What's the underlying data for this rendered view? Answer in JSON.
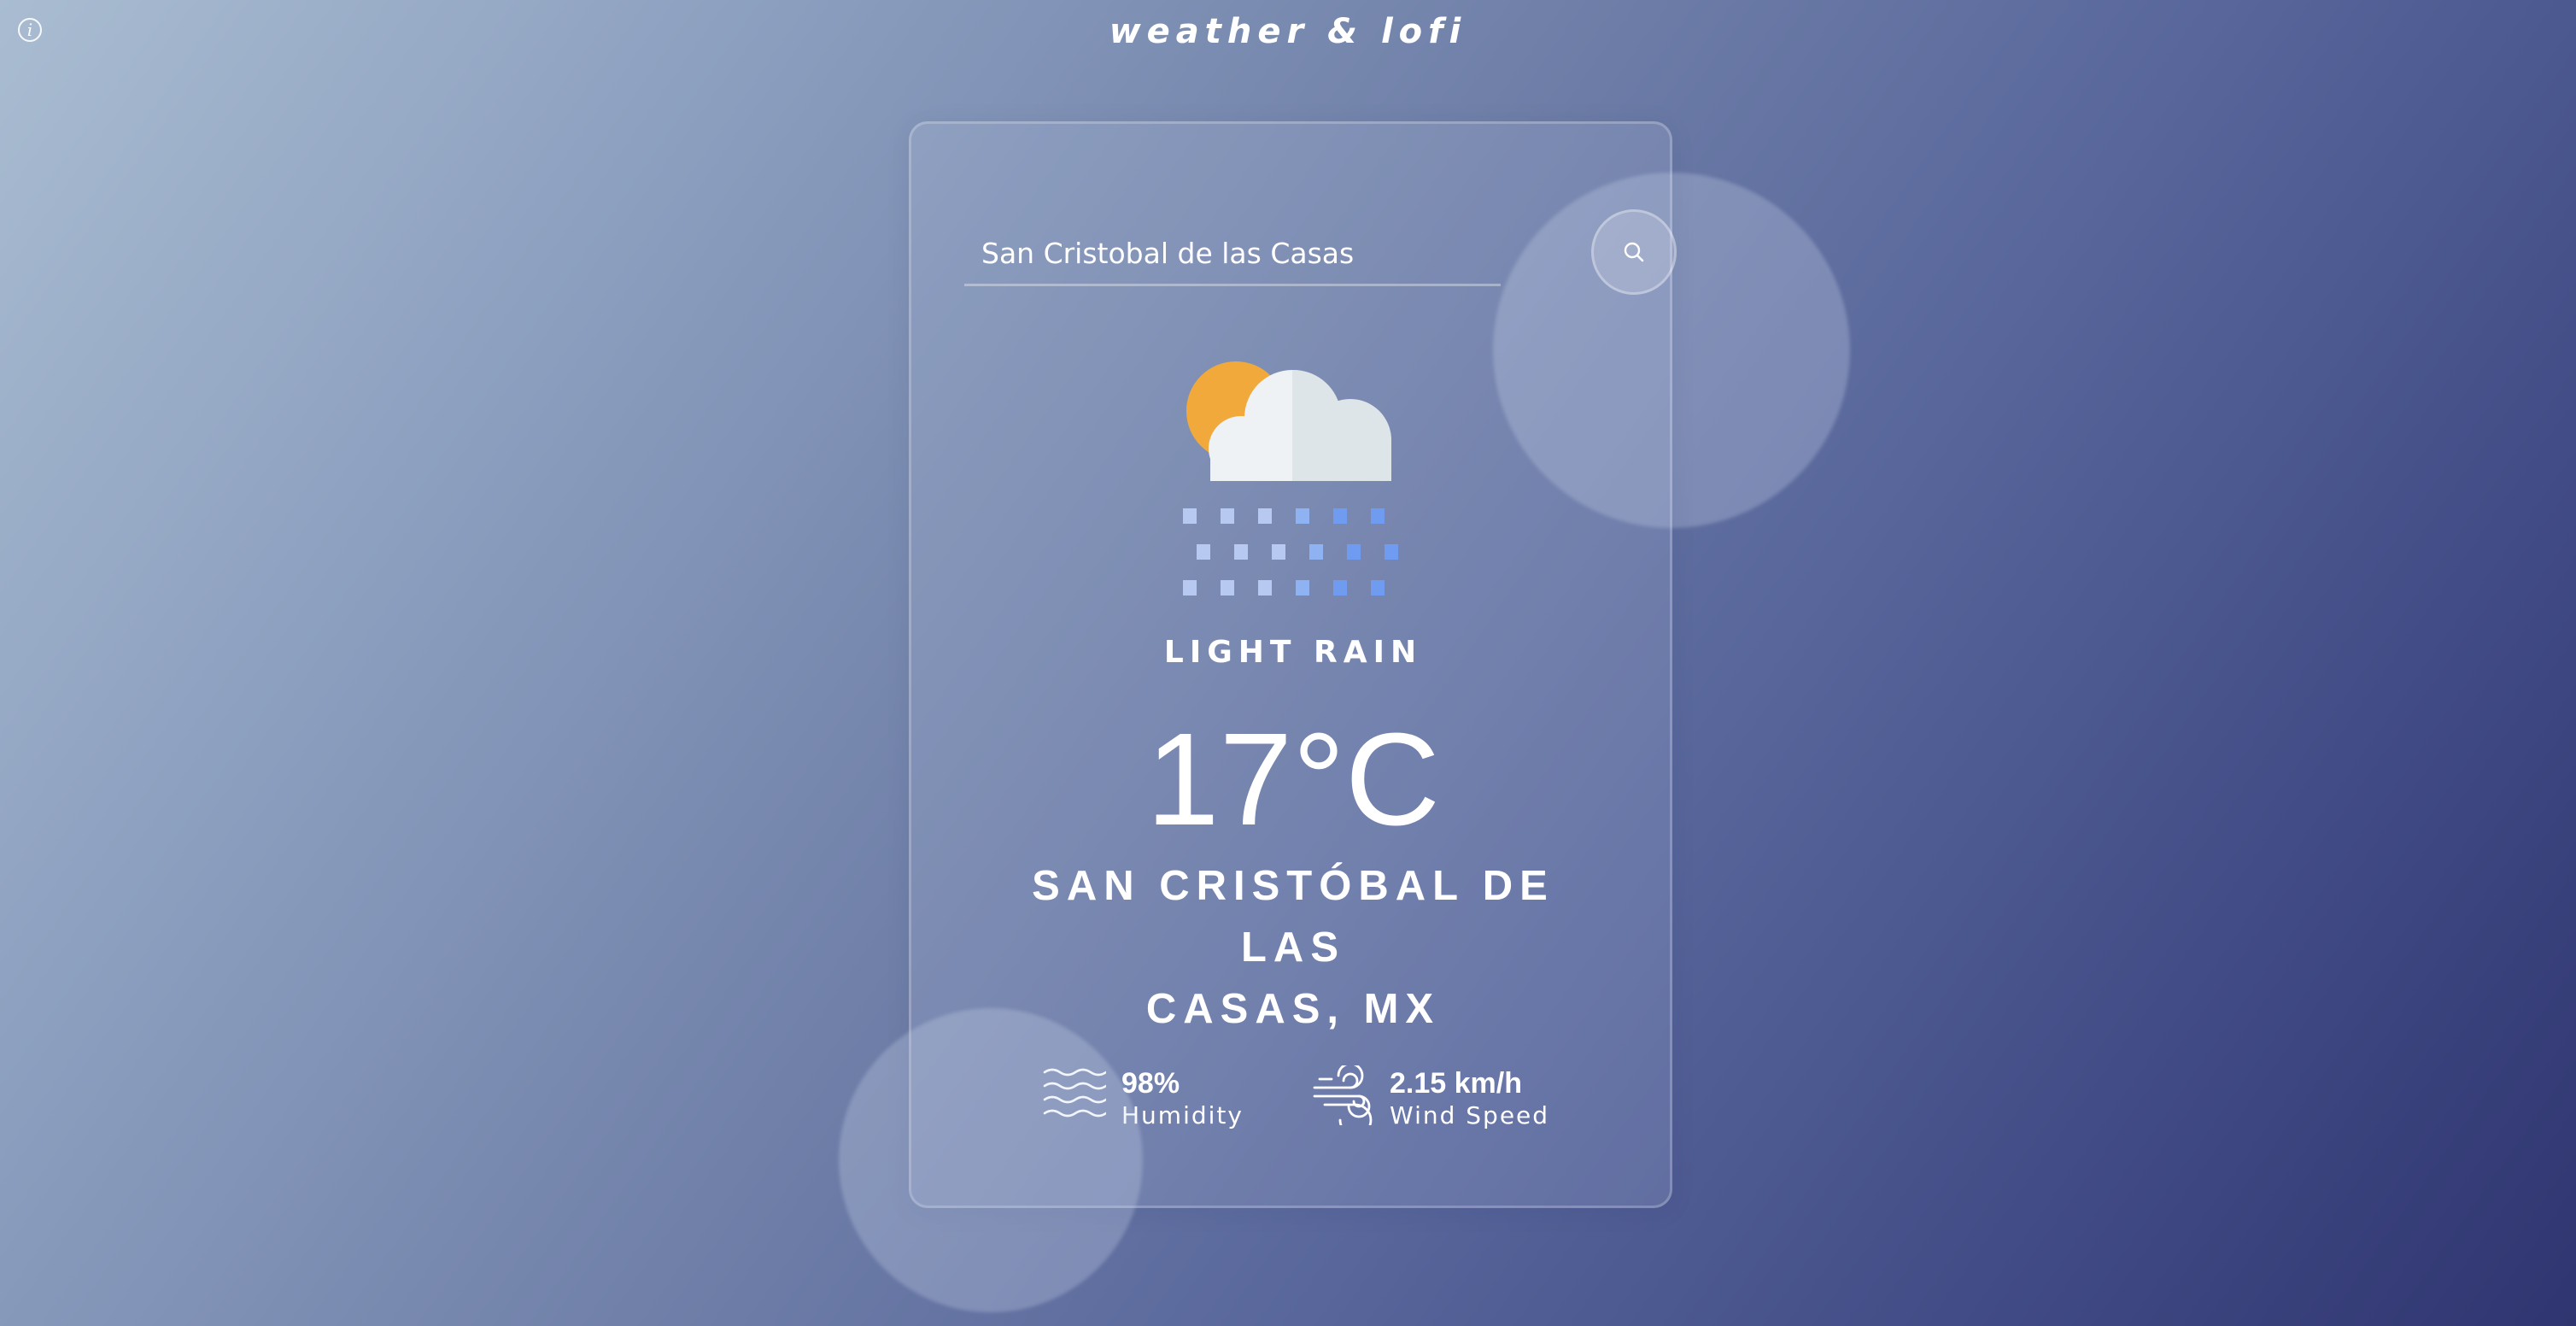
{
  "app": {
    "title": "weather & lofi",
    "info_icon": "info-icon"
  },
  "search": {
    "value": "San Cristobal de las Casas",
    "placeholder": "",
    "button_icon": "search-icon"
  },
  "weather": {
    "icon": "sun-cloud-rain-icon",
    "description": "LIGHT RAIN",
    "temperature": "17°C",
    "city_line_1": "SAN CRISTÓBAL DE LAS",
    "city_line_2": "CASAS, MX"
  },
  "stats": {
    "humidity": {
      "icon": "humidity-waves-icon",
      "value": "98%",
      "label": "Humidity"
    },
    "wind": {
      "icon": "wind-icon",
      "value": "2.15 km/h",
      "label": "Wind Speed"
    }
  },
  "colors": {
    "background_start": "#a9bcd1",
    "background_end": "#2f3570",
    "sun": "#f2a93b",
    "cloud": "#eef2f4",
    "rain_light": "#b7c9f0",
    "rain_dark": "#6f9cf0"
  }
}
